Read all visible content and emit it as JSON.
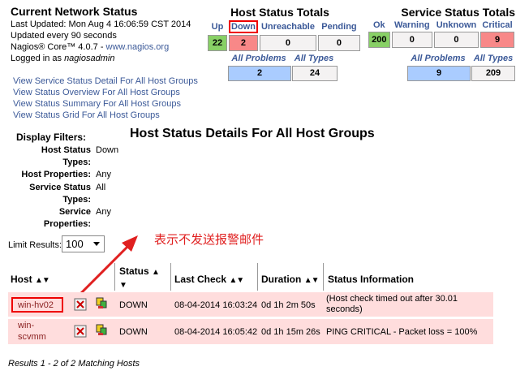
{
  "info": {
    "title": "Current Network Status",
    "last_updated": "Last Updated: Mon Aug 4 16:06:59 CST 2014",
    "update_interval": "Updated every 90 seconds",
    "version_prefix": "Nagios® Core™ 4.0.7 - ",
    "version_link": "www.nagios.org",
    "logged_prefix": "Logged in as ",
    "logged_user": "nagiosadmin"
  },
  "nav_links": [
    "View Service Status Detail For All Host Groups",
    "View Status Overview For All Host Groups",
    "View Status Summary For All Host Groups",
    "View Status Grid For All Host Groups"
  ],
  "host_totals": {
    "title": "Host Status Totals",
    "headers": [
      "Up",
      "Down",
      "Unreachable",
      "Pending"
    ],
    "values": [
      "22",
      "2",
      "0",
      "0"
    ],
    "sub_headers": [
      "All Problems",
      "All Types"
    ],
    "sub_values": [
      "2",
      "24"
    ]
  },
  "service_totals": {
    "title": "Service Status Totals",
    "headers": [
      "Ok",
      "Warning",
      "Unknown",
      "Critical"
    ],
    "values": [
      "200",
      "0",
      "0",
      "9"
    ],
    "sub_headers": [
      "All Problems",
      "All Types"
    ],
    "sub_values": [
      "9",
      "209"
    ]
  },
  "display_filters": {
    "title": "Display Filters:",
    "rows": [
      {
        "label": "Host Status Types:",
        "value": "Down"
      },
      {
        "label": "Host Properties:",
        "value": "Any"
      },
      {
        "label": "Service Status Types:",
        "value": "All"
      },
      {
        "label": "Service Properties:",
        "value": "Any"
      }
    ]
  },
  "main_title": "Host Status Details For All Host Groups",
  "limit": {
    "label": "Limit Results:",
    "value": "100"
  },
  "annotation": "表示不发送报警邮件",
  "table": {
    "headers": [
      "Host",
      "Status",
      "Last Check",
      "Duration",
      "Status Information"
    ],
    "rows": [
      {
        "host": "win-hv02",
        "status": "DOWN",
        "last_check": "08-04-2014 16:03:24",
        "duration": "0d 1h 2m 50s",
        "info": "(Host check timed out after 30.01 seconds)"
      },
      {
        "host": "win-scvmm",
        "status": "DOWN",
        "last_check": "08-04-2014 16:05:42",
        "duration": "0d 1h 15m 26s",
        "info": "PING CRITICAL - Packet loss = 100%"
      }
    ]
  },
  "footer": "Results 1 - 2 of 2 Matching Hosts",
  "colors": {
    "up": "#88d066",
    "down": "#f88888",
    "problems": "#aaccff",
    "row": "#ffdddd",
    "annotation": "#e02020"
  }
}
